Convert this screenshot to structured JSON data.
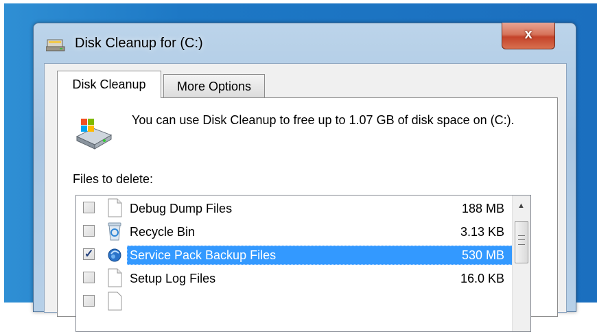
{
  "window": {
    "title": "Disk Cleanup for  (C:)",
    "close_label": "x"
  },
  "tabs": [
    {
      "label": "Disk Cleanup",
      "active": true
    },
    {
      "label": "More Options",
      "active": false
    }
  ],
  "content": {
    "description": "You can use Disk Cleanup to free up to 1.07 GB of disk space on  (C:).",
    "files_label": "Files to delete:"
  },
  "files": [
    {
      "name": "Debug Dump Files",
      "size": "188 MB",
      "checked": false,
      "icon": "document-icon"
    },
    {
      "name": "Recycle Bin",
      "size": "3.13 KB",
      "checked": false,
      "icon": "recycle-bin-icon"
    },
    {
      "name": "Service Pack Backup Files",
      "size": "530 MB",
      "checked": true,
      "selected": true,
      "icon": "windows-update-icon"
    },
    {
      "name": "Setup Log Files",
      "size": "16.0 KB",
      "checked": false,
      "icon": "document-icon"
    }
  ],
  "colors": {
    "selection": "#3399ff",
    "close_button": "#c4432a",
    "title_bar": "#bcd4ea"
  }
}
